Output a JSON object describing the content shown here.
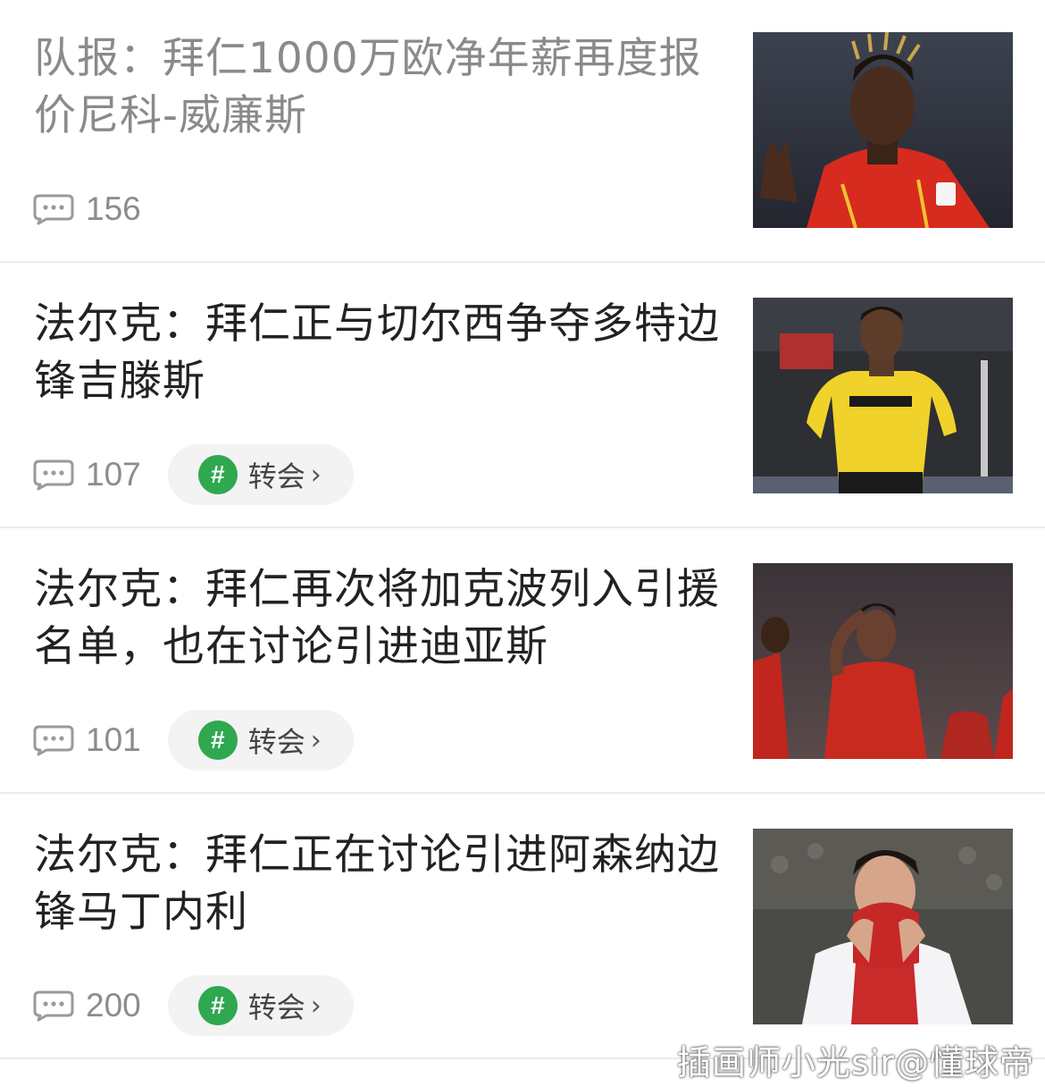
{
  "articles": [
    {
      "title": "队报：拜仁1000万欧净年薪再度报价尼科-威廉斯",
      "comments": "156",
      "tag": null,
      "image": "player-spain-red-jersey"
    },
    {
      "title": "法尔克：拜仁正与切尔西争夺多特边锋吉滕斯",
      "comments": "107",
      "tag": {
        "label": "转会",
        "hash": "#",
        "chevron": "›"
      },
      "image": "player-dortmund-yellow-jersey"
    },
    {
      "title": "法尔克：拜仁再次将加克波列入引援名单，也在讨论引进迪亚斯",
      "comments": "101",
      "tag": {
        "label": "转会",
        "hash": "#",
        "chevron": "›"
      },
      "image": "players-liverpool-red-jersey"
    },
    {
      "title": "法尔克：拜仁正在讨论引进阿森纳边锋马丁内利",
      "comments": "200",
      "tag": {
        "label": "转会",
        "hash": "#",
        "chevron": "›"
      },
      "image": "player-arsenal-covering-face"
    }
  ],
  "watermark": "插画师小光sir@懂球帝",
  "colors": {
    "tag_green": "#2fa84f",
    "read_title": "#8a8a8a",
    "title": "#222222"
  }
}
